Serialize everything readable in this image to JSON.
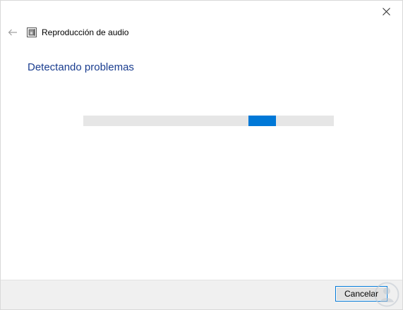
{
  "window": {
    "title": "Reproducción de audio",
    "close_icon": "close-icon",
    "back_icon": "back-arrow-icon",
    "app_icon": "audio-troubleshooter-icon"
  },
  "main": {
    "heading": "Detectando problemas",
    "progress": {
      "mode": "indeterminate",
      "chunk_start_fraction": 0.66,
      "chunk_width_fraction": 0.11,
      "color": "#0078d7"
    }
  },
  "footer": {
    "cancel_label": "Cancelar"
  },
  "colors": {
    "heading": "#1a3d8f",
    "accent": "#0078d7",
    "footer_bg": "#f0f0f0"
  }
}
